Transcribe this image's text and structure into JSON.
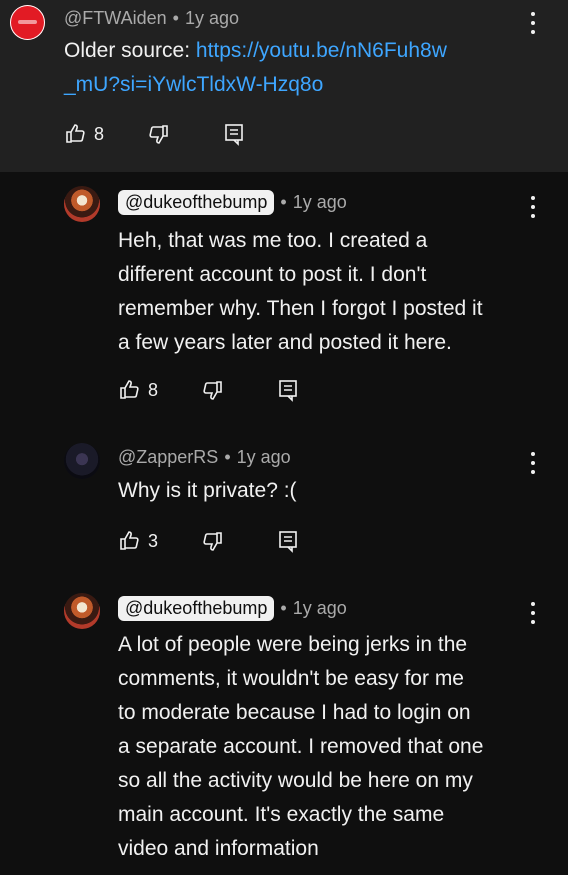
{
  "comments": [
    {
      "author": "@FTWAiden",
      "time": "1y ago",
      "text_prefix": "Older source: ",
      "link_line1": "https://youtu.be/nN6Fuh8w",
      "link_line2": "_mU?si=iYwlcTldxW-Hzq8o",
      "likes": "8"
    },
    {
      "author": "@dukeofthebump",
      "time": "1y ago",
      "lines": [
        "Heh, that was me too. I created a",
        "different account to post it. I don't",
        "remember why. Then I forgot I posted it",
        "a few years later and posted it here."
      ],
      "likes": "8"
    },
    {
      "author": "@ZapperRS",
      "time": "1y ago",
      "lines": [
        "Why is it private? :("
      ],
      "likes": "3"
    },
    {
      "author": "@dukeofthebump",
      "time": "1y ago",
      "lines": [
        "A lot of people were being jerks in the",
        "comments, it wouldn't be easy for me",
        "to moderate because I had to login on",
        "a separate account. I removed that one",
        "so all the activity would be here on my",
        "main account. It's exactly the same",
        "video and information"
      ]
    }
  ],
  "separator": "•",
  "icons": [
    "thumbs-up-icon",
    "thumbs-down-icon",
    "reply-icon",
    "more-vert-icon"
  ],
  "colors": {
    "background": "#0f0f0f",
    "highlight": "#212121",
    "link": "#3ea6ff",
    "meta": "#aaaaaa"
  }
}
